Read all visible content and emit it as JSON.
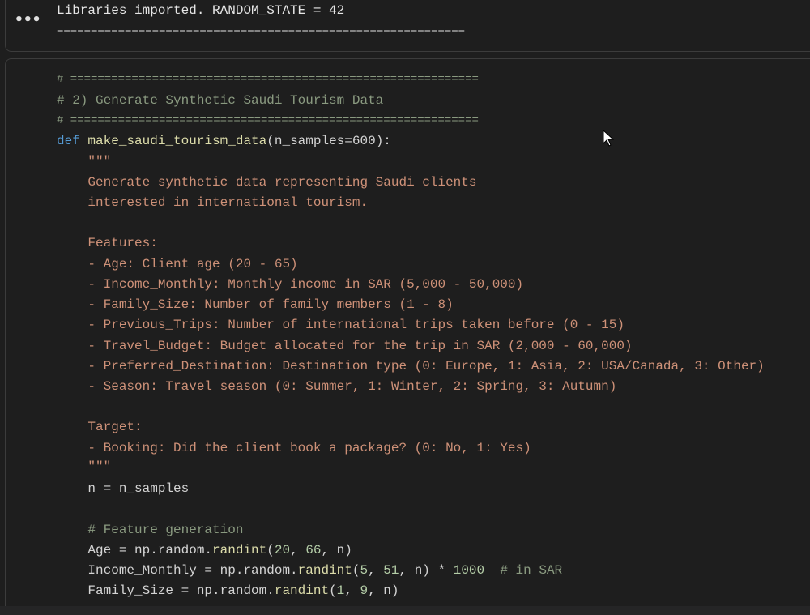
{
  "output": {
    "more_label": "•••",
    "line1": "Libraries imported. RANDOM_STATE = 42",
    "line2": "============================================================"
  },
  "code": {
    "l01": "# ============================================================",
    "l02": "# 2) Generate Synthetic Saudi Tourism Data",
    "l03": "# ============================================================",
    "l04_kw": "def",
    "l04_fn": "make_saudi_tourism_data",
    "l04_args": "(n_samples=600):",
    "l05": "    \"\"\"",
    "l06": "    Generate synthetic data representing Saudi clients",
    "l07": "    interested in international tourism.",
    "l09": "    Features:",
    "l10": "    - Age: Client age (20 - 65)",
    "l11": "    - Income_Monthly: Monthly income in SAR (5,000 - 50,000)",
    "l12": "    - Family_Size: Number of family members (1 - 8)",
    "l13": "    - Previous_Trips: Number of international trips taken before (0 - 15)",
    "l14": "    - Travel_Budget: Budget allocated for the trip in SAR (2,000 - 60,000)",
    "l15": "    - Preferred_Destination: Destination type (0: Europe, 1: Asia, 2: USA/Canada, 3: Other)",
    "l16": "    - Season: Travel season (0: Summer, 1: Winter, 2: Spring, 3: Autumn)",
    "l18": "    Target:",
    "l19": "    - Booking: Did the client book a package? (0: No, 1: Yes)",
    "l20": "    \"\"\"",
    "l21": "    n = n_samples",
    "l23": "    # Feature generation",
    "l24_a": "    Age = np.random.",
    "l24_fn": "randint",
    "l24_b": "(",
    "l24_n1": "20",
    "l24_c": ", ",
    "l24_n2": "66",
    "l24_d": ", n)",
    "l25_a": "    Income_Monthly = np.random.",
    "l25_fn": "randint",
    "l25_b": "(",
    "l25_n1": "5",
    "l25_c": ", ",
    "l25_n2": "51",
    "l25_d": ", n) * ",
    "l25_n3": "1000",
    "l25_cmt": "  # in SAR",
    "l26_a": "    Family_Size = np.random.",
    "l26_fn": "randint",
    "l26_b": "(",
    "l26_n1": "1",
    "l26_c": ", ",
    "l26_n2": "9",
    "l26_d": ", n)"
  }
}
